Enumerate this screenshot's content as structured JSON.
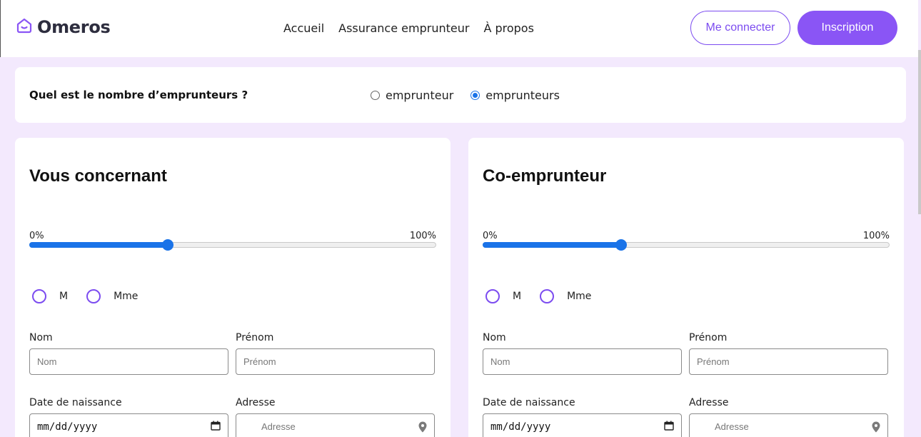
{
  "brand": {
    "name": "Omeros",
    "accent": "#8a55f5"
  },
  "nav": {
    "items": [
      "Accueil",
      "Assurance emprunteur",
      "À propos"
    ]
  },
  "header": {
    "login_label": "Me connecter",
    "signup_label": "Inscription"
  },
  "borrowers": {
    "question": "Quel est le nombre d’emprunteurs ?",
    "options": [
      "emprunteur",
      "emprunteurs"
    ],
    "selected": "emprunteurs"
  },
  "panels": [
    {
      "title": "Vous concernant",
      "slider": {
        "min_label": "0%",
        "max_label": "100%",
        "value_percent": 34
      },
      "civility": [
        "M",
        "Mme"
      ],
      "fields": {
        "nom_label": "Nom",
        "nom_placeholder": "Nom",
        "prenom_label": "Prénom",
        "prenom_placeholder": "Prénom",
        "date_label": "Date de naissance",
        "date_placeholder": "mm/dd/yyyy",
        "adresse_label": "Adresse",
        "adresse_placeholder": "Adresse"
      }
    },
    {
      "title": "Co-emprunteur",
      "slider": {
        "min_label": "0%",
        "max_label": "100%",
        "value_percent": 34
      },
      "civility": [
        "M",
        "Mme"
      ],
      "fields": {
        "nom_label": "Nom",
        "nom_placeholder": "Nom",
        "prenom_label": "Prénom",
        "prenom_placeholder": "Prénom",
        "date_label": "Date de naissance",
        "date_placeholder": "mm/dd/yyyy",
        "adresse_label": "Adresse",
        "adresse_placeholder": "Adresse"
      }
    }
  ],
  "icons": [
    "home-logo-icon",
    "calendar-icon",
    "location-pin-icon"
  ]
}
